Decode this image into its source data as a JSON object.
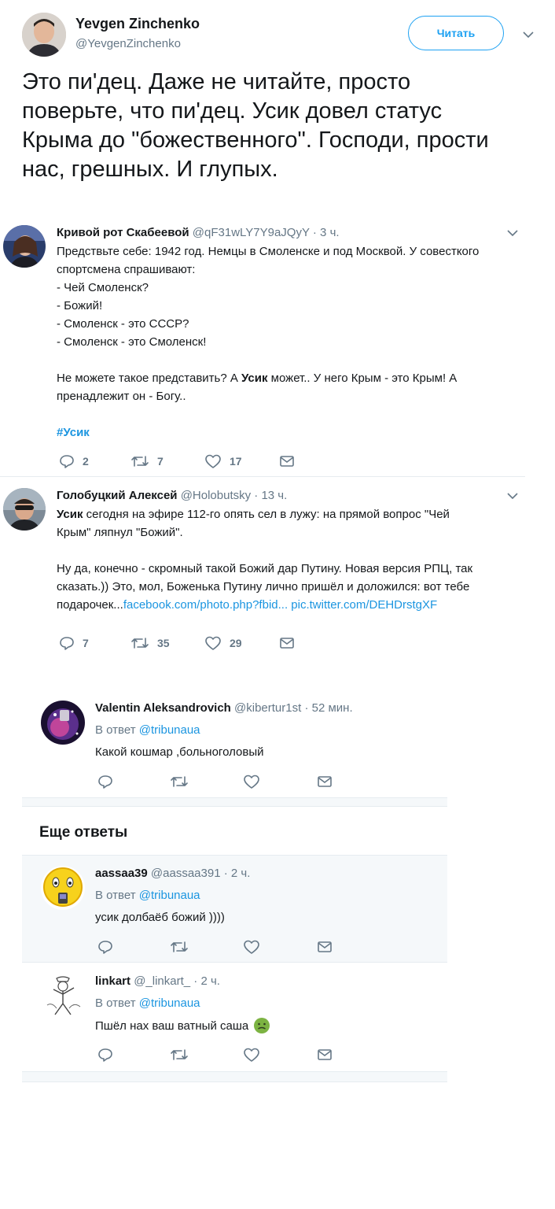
{
  "main_tweet": {
    "author_name": "Yevgen Zinchenko",
    "author_handle": "@YevgenZinchenko",
    "follow_label": "Читать",
    "text": "Это пи'дец. Даже не читайте, просто поверьте, что пи'дец. Усик довел статус Крыма до \"божественного\".  Господи, прости нас, грешных. И глупых."
  },
  "quoted_tweets": [
    {
      "author_name": "Кривой рот Скабеевой",
      "author_handle": "@qF31wLY7Y9aJQyY",
      "time": "· 3 ч.",
      "lines": [
        "Предствьте себе: 1942 год. Немцы в Смоленске и под Москвой. У совесткого",
        "спортсмена спрашивают:",
        "- Чей Смоленск?",
        "- Божий!",
        "- Смоленск - это СССР?",
        "- Смоленск - это Смоленск!"
      ],
      "para2_prefix": "Не можете такое представить? А ",
      "para2_bold": "Усик",
      "para2_suffix": " может.. У него Крым - это Крым! А",
      "para2_line2": "пренадлежит он - Богу..",
      "hashtag": "#Усик",
      "replies": "2",
      "retweets": "7",
      "likes": "17"
    },
    {
      "author_name": "Голобуцкий Алексей",
      "author_handle": "@Holobutsky",
      "time": "· 13 ч.",
      "line1_bold": "Усик",
      "line1_rest": " сегодня на эфире 112-го опять сел в лужу: на прямой вопрос \"Чей",
      "line2": "Крым\" ляпнул \"Божий\".",
      "line3": "Ну да, конечно - скромный такой Божий дар Путину. Новая версия РПЦ, так",
      "line4": "сказать.)) Это, мол, Боженька Путину лично пришёл и доложился: вот тебе",
      "line5_prefix": "подарочек...",
      "link1": "facebook.com/photo.php?fbid...",
      "link2": "pic.twitter.com/DEHDrstgXF",
      "replies": "7",
      "retweets": "35",
      "likes": "29"
    }
  ],
  "reply_prefix": "В ответ ",
  "replies": [
    {
      "author_name": "Valentin Aleksandrovich",
      "author_handle": "@kibertur1st",
      "time": "· 52 мин.",
      "reply_to": "@tribunaua",
      "text": "Какой кошмар ,больноголовый"
    },
    {
      "author_name": "aassaa39",
      "author_handle": "@aassaa391",
      "time": "· 2 ч.",
      "reply_to": "@tribunaua",
      "text": "усик долбаёб божий ))))"
    },
    {
      "author_name": "linkart",
      "author_handle": "@_linkart_",
      "time": "· 2 ч.",
      "reply_to": "@tribunaua",
      "text": "Пшёл нах ваш ватный саша"
    }
  ],
  "more_replies_title": "Еще ответы",
  "colors": {
    "link": "#1b95e0",
    "muted": "#657786",
    "separator": "#e6ecf0",
    "highlight_bg": "#f5f8fa"
  },
  "icons": [
    "reply-icon",
    "retweet-icon",
    "like-icon",
    "message-icon",
    "chevron-down-icon",
    "nauseated-face-emoji"
  ]
}
